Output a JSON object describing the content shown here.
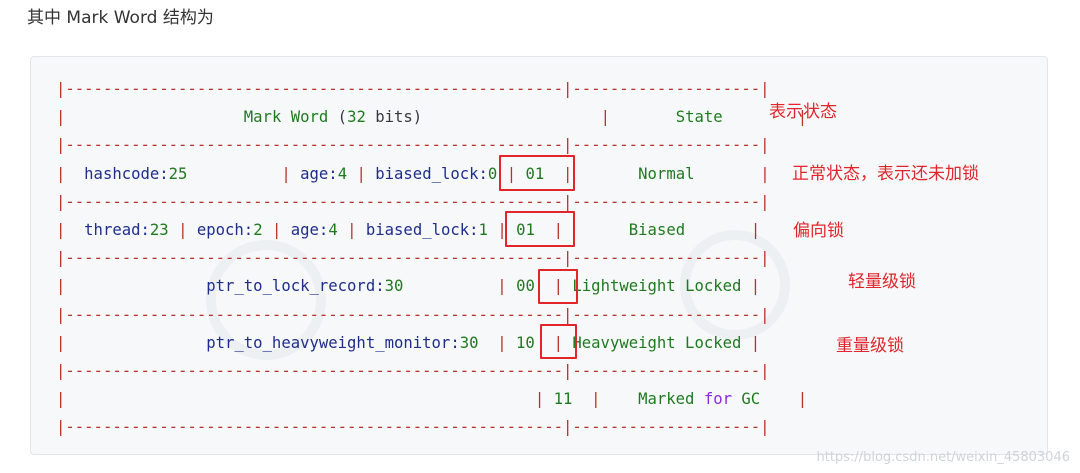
{
  "heading": "其中 Mark Word 结构为",
  "table": {
    "border_line": "|-----------------------------------------------------|--------------------|",
    "header": {
      "title": "Mark Word",
      "bits_open": "(",
      "bits_num": "32",
      "bits_word": "bits",
      "bits_close": ")",
      "state": "State"
    },
    "rows": [
      {
        "fields": [
          "hashcode:",
          "25",
          "age:",
          "4",
          "biased_lock:",
          "0",
          "01"
        ],
        "state": "Normal"
      },
      {
        "fields": [
          "thread:",
          "23",
          "epoch:",
          "2",
          "age:",
          "4",
          "biased_lock:",
          "1",
          "01"
        ],
        "state": "Biased"
      },
      {
        "fields": [
          "ptr_to_lock_record:",
          "30",
          "00"
        ],
        "state": "Lightweight Locked"
      },
      {
        "fields": [
          "ptr_to_heavyweight_monitor:",
          "30",
          "10"
        ],
        "state": "Heavyweight Locked"
      },
      {
        "fields": [
          "11"
        ],
        "state_pre": "Marked",
        "state_kw": "for",
        "state_post": "GC"
      }
    ]
  },
  "annotations": {
    "state": "表示状态",
    "normal": "正常状态，表示还未加锁",
    "biased": "偏向锁",
    "lightweight": "轻量级锁",
    "heavyweight": "重量级锁"
  },
  "watermark": "https://blog.csdn.net/weixin_45803046",
  "colors": {
    "border": "#b8322a",
    "value": "#1f7a1f",
    "field": "#1f2d8c",
    "highlight": "#e1252b"
  }
}
